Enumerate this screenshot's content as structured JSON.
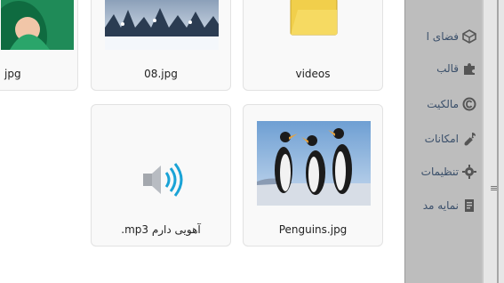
{
  "files": [
    {
      "name": "jpg"
    },
    {
      "name": "08.jpg"
    },
    {
      "name": "videos"
    },
    {
      "name": ".mp3 آهویی دارم"
    },
    {
      "name": "Penguins.jpg"
    }
  ],
  "sidebar": {
    "items": [
      {
        "label": "فضای ا",
        "icon": "cube-icon"
      },
      {
        "label": "قالب",
        "icon": "puzzle-icon"
      },
      {
        "label": "مالکیت",
        "icon": "copyright-icon"
      },
      {
        "label": "امکانات",
        "icon": "wrench-icon"
      },
      {
        "label": "تنظیمات",
        "icon": "gear-icon"
      },
      {
        "label": "نمایه مد",
        "icon": "document-icon"
      }
    ],
    "accent": "#3a4f6a",
    "background": "#bdbdbd"
  },
  "right_bar": {
    "handle": "≡"
  }
}
